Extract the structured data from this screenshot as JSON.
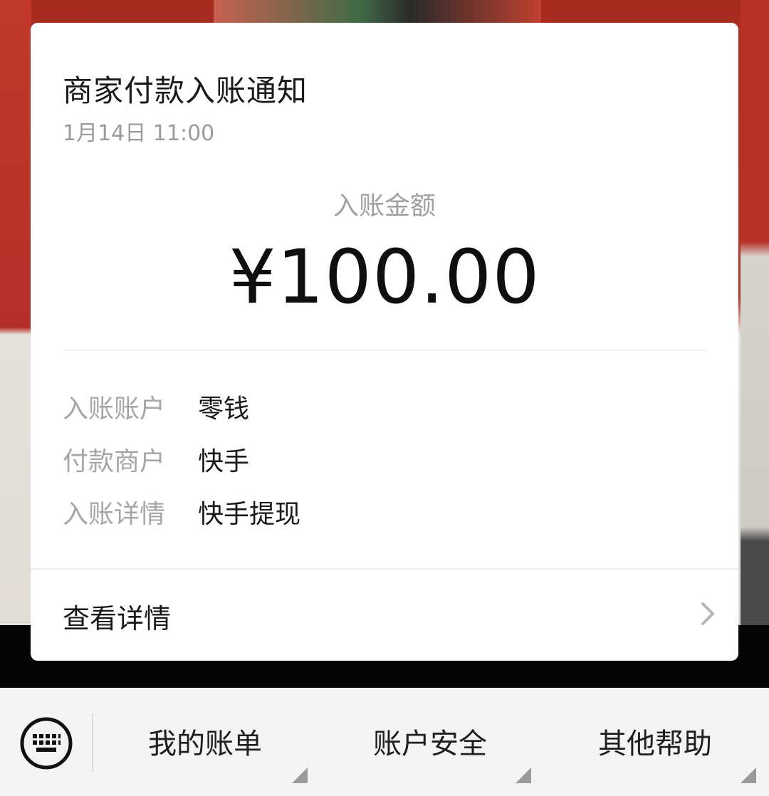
{
  "notification": {
    "title": "商家付款入账通知",
    "time": "1月14日 11:00",
    "amount_label": "入账金额",
    "amount": "¥100.00",
    "rows": [
      {
        "key": "入账账户",
        "value": "零钱"
      },
      {
        "key": "付款商户",
        "value": "快手"
      },
      {
        "key": "入账详情",
        "value": "快手提现"
      }
    ],
    "detail_link": "查看详情"
  },
  "bottom_menu": {
    "items": [
      "我的账单",
      "账户安全",
      "其他帮助"
    ]
  },
  "icons": {
    "keyboard": "keyboard-icon",
    "chevron": "chevron-right-icon"
  }
}
